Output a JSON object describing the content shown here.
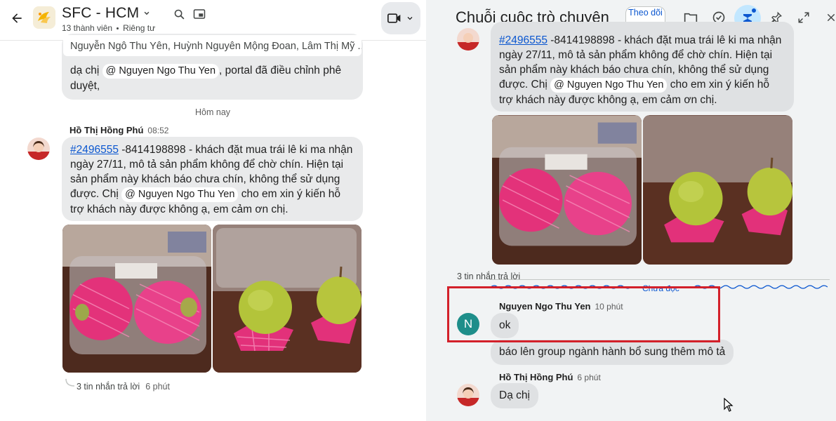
{
  "left": {
    "space_name": "SFC - HCM",
    "members": "13 thành viên",
    "visibility": "Riêng tư",
    "quote_preview": "Nguyễn Ngô Thu Yên, Huỳnh Nguyên Mộng Đoan, Lâm Thị Mỹ ...",
    "prev_message_before": "dạ chị ",
    "prev_message_mention": "@ Nguyen Ngo Thu Yen",
    "prev_message_after": ", portal đã điều chỉnh phê duyệt,",
    "day_divider": "Hôm nay",
    "msg_sender": "Hồ Thị Hồng Phú",
    "msg_time": "08:52",
    "msg_link": "#2496555",
    "msg_text_1": " -8414198898 - khách đặt mua trái lê ki ma nhận ngày 27/11, mô tả sản phẩm không để chờ chín. Hiện tại sản phẩm này khách báo chưa chín, không thể sử dụng được. Chị ",
    "msg_mention": "@ Nguyen Ngo Thu Yen",
    "msg_text_2": " cho em xin ý kiến hỗ trợ khách này được không ạ, em cảm ơn chị.",
    "thread_summary": "3 tin nhắn trả lời",
    "thread_time": "6 phút"
  },
  "right": {
    "title": "Chuỗi cuộc trò chuyện",
    "follow_label": "Theo dõi",
    "msg_link": "#2496555",
    "msg_text_1": " -8414198898 - khách đặt mua trái lê ki ma nhận ngày 27/11, mô tả sản phẩm không để chờ chín. Hiện tại sản phẩm này khách báo chưa chín, không thể sử dụng được. Chị ",
    "msg_mention": "@ Nguyen Ngo Thu Yen",
    "msg_text_2": " cho em xin ý kiến hỗ trợ khách này được không ạ, em cảm ơn chị.",
    "replies_count": "3 tin nhắn trả lời",
    "unread_label": "Chưa đọc",
    "reply1_sender": "Nguyen Ngo Thu Yen",
    "reply1_time": "10 phút",
    "reply1_avatar": "N",
    "reply1_msg1": "ok",
    "reply1_msg2": "báo lên group ngành hành bổ sung thêm mô tả",
    "reply2_sender": "Hồ Thị Hồng Phú",
    "reply2_time": "6 phút",
    "reply2_msg": "Dạ chị"
  },
  "icons": {
    "back": "arrow-left-icon",
    "search": "search-icon",
    "picture_in_picture": "pip-icon",
    "video": "video-camera-icon",
    "folder": "folder-icon",
    "task": "check-circle-icon",
    "summarize": "summarize-icon",
    "pin": "pin-icon",
    "expand": "expand-icon",
    "close": "close-icon"
  },
  "colors": {
    "accent": "#0b57d0",
    "highlight": "#d3202a",
    "avatar_n": "#1e8e8a"
  }
}
